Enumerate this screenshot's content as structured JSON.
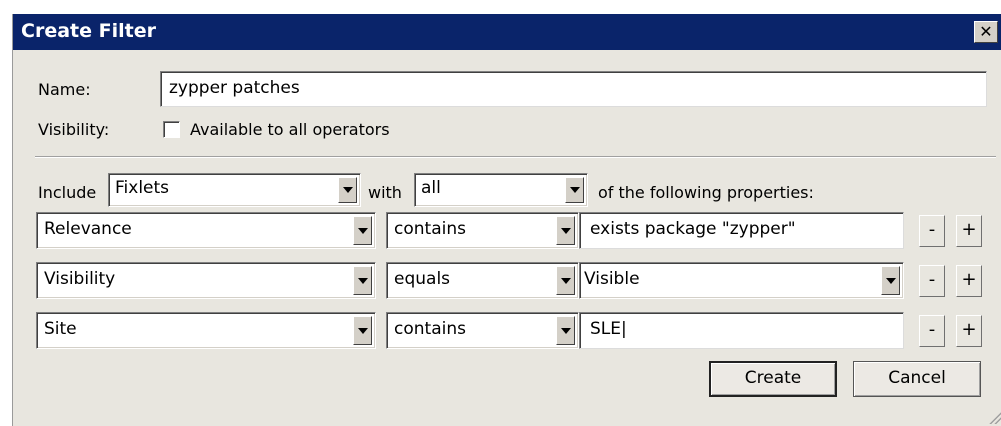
{
  "dialog": {
    "title": "Create Filter",
    "close_glyph": "✕"
  },
  "name": {
    "label": "Name:",
    "value": "zypper patches"
  },
  "visibility": {
    "label": "Visibility:",
    "checkbox_label": "Available to all operators",
    "checked": false
  },
  "include_row": {
    "include_label": "Include",
    "type_value": "Fixlets",
    "with_label": "with",
    "match_value": "all",
    "suffix_label": "of the following properties:"
  },
  "conditions": [
    {
      "property": "Relevance",
      "operator": "contains",
      "value": "exists package \"zypper\"",
      "value_is_dropdown": false
    },
    {
      "property": "Visibility",
      "operator": "equals",
      "value": "Visible",
      "value_is_dropdown": true
    },
    {
      "property": "Site",
      "operator": "contains",
      "value": "SLE|",
      "value_is_dropdown": false
    }
  ],
  "row_buttons": {
    "minus": "-",
    "plus": "+"
  },
  "footer": {
    "create_label": "Create",
    "cancel_label": "Cancel"
  }
}
